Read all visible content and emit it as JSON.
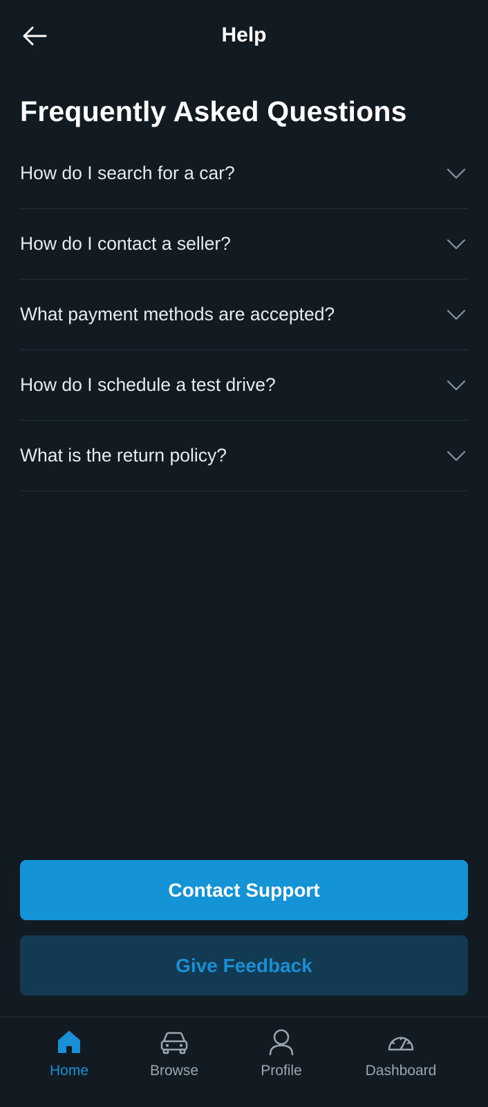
{
  "header": {
    "title": "Help",
    "back_icon": "arrow-left-icon"
  },
  "faq": {
    "title": "Frequently Asked Questions",
    "items": [
      {
        "question": "How do I search for a car?"
      },
      {
        "question": "How do I contact a seller?"
      },
      {
        "question": "What payment methods are accepted?"
      },
      {
        "question": "How do I schedule a test drive?"
      },
      {
        "question": "What is the return policy?"
      }
    ]
  },
  "actions": {
    "contact_support_label": "Contact Support",
    "give_feedback_label": "Give Feedback"
  },
  "nav": {
    "items": [
      {
        "label": "Home",
        "icon": "home-icon",
        "active": true
      },
      {
        "label": "Browse",
        "icon": "car-icon",
        "active": false
      },
      {
        "label": "Profile",
        "icon": "user-icon",
        "active": false
      },
      {
        "label": "Dashboard",
        "icon": "speedometer-icon",
        "active": false
      }
    ]
  },
  "colors": {
    "background": "#121b22",
    "accent": "#1493d6",
    "secondary_button": "#123a52",
    "divider": "#243240",
    "muted_text": "#9aa7b2"
  }
}
